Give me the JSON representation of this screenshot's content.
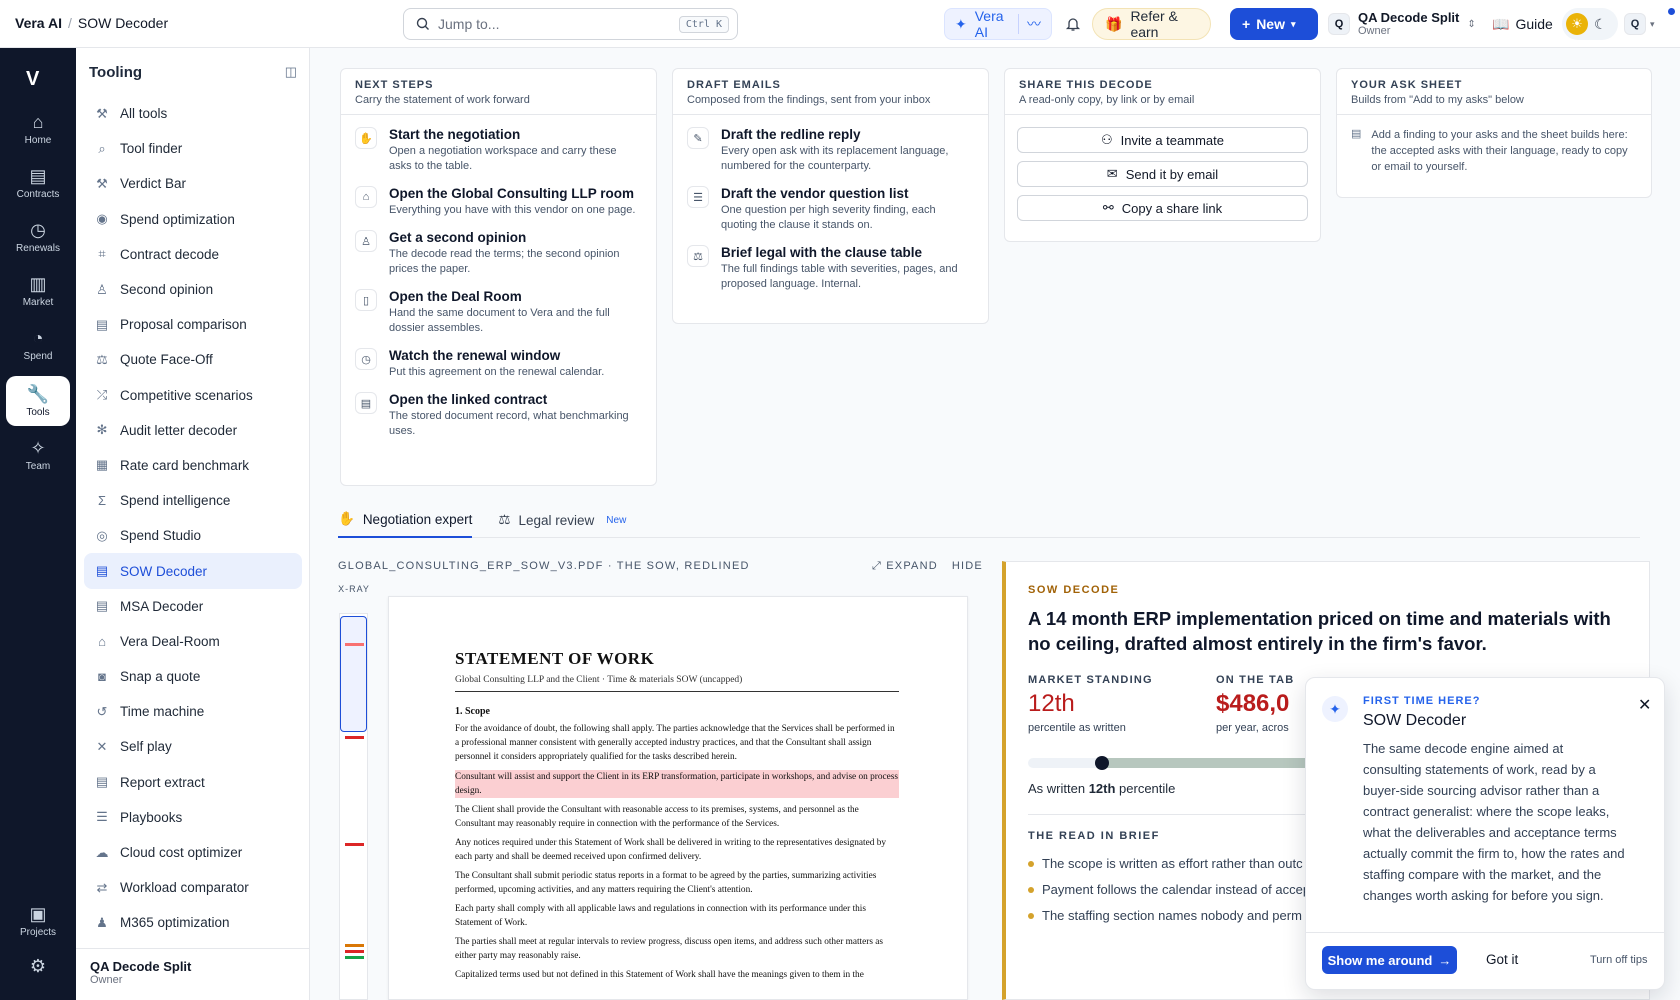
{
  "app": {
    "brand": "Vera AI",
    "page": "SOW Decoder"
  },
  "search": {
    "placeholder": "Jump to...",
    "shortcut": "Ctrl K"
  },
  "topbar": {
    "vera_label": "Vera AI",
    "refer_label": "Refer & earn",
    "new_label": "New",
    "workspace_initial": "Q",
    "workspace_name": "QA Decode Split",
    "workspace_role": "Owner",
    "guide_label": "Guide",
    "user_initial": "Q"
  },
  "rail": [
    {
      "label": "Home",
      "icon": "home-icon"
    },
    {
      "label": "Contracts",
      "icon": "contract-icon"
    },
    {
      "label": "Renewals",
      "icon": "calendar-icon"
    },
    {
      "label": "Market",
      "icon": "bar-chart-icon"
    },
    {
      "label": "Spend",
      "icon": "pie-chart-icon"
    },
    {
      "label": "Tools",
      "icon": "wrench-icon"
    },
    {
      "label": "Team",
      "icon": "sparkle-icon"
    },
    {
      "label": "Projects",
      "icon": "folder-icon"
    }
  ],
  "sidebar": {
    "title": "Tooling",
    "items": [
      "All tools",
      "Tool finder",
      "Verdict Bar",
      "Spend optimization",
      "Contract decode",
      "Second opinion",
      "Proposal comparison",
      "Quote Face-Off",
      "Competitive scenarios",
      "Audit letter decoder",
      "Rate card benchmark",
      "Spend intelligence",
      "Spend Studio",
      "SOW Decoder",
      "MSA Decoder",
      "Vera Deal-Room",
      "Snap a quote",
      "Time machine",
      "Self play",
      "Report extract",
      "Playbooks",
      "Cloud cost optimizer",
      "Workload comparator",
      "M365 optimization"
    ],
    "footer_name": "QA Decode Split",
    "footer_role": "Owner"
  },
  "next_steps": {
    "title": "NEXT STEPS",
    "subtitle": "Carry the statement of work forward",
    "items": [
      {
        "title": "Start the negotiation",
        "desc": "Open a negotiation workspace and carry these asks to the table."
      },
      {
        "title": "Open the Global Consulting LLP room",
        "desc": "Everything you have with this vendor on one page."
      },
      {
        "title": "Get a second opinion",
        "desc": "The decode read the terms; the second opinion prices the paper."
      },
      {
        "title": "Open the Deal Room",
        "desc": "Hand the same document to Vera and the full dossier assembles."
      },
      {
        "title": "Watch the renewal window",
        "desc": "Put this agreement on the renewal calendar."
      },
      {
        "title": "Open the linked contract",
        "desc": "The stored document record, what benchmarking uses."
      }
    ]
  },
  "draft_emails": {
    "title": "DRAFT EMAILS",
    "subtitle": "Composed from the findings, sent from your inbox",
    "items": [
      {
        "title": "Draft the redline reply",
        "desc": "Every open ask with its replacement language, numbered for the counterparty."
      },
      {
        "title": "Draft the vendor question list",
        "desc": "One question per high severity finding, each quoting the clause it stands on."
      },
      {
        "title": "Brief legal with the clause table",
        "desc": "The full findings table with severities, pages, and proposed language. Internal."
      }
    ]
  },
  "share": {
    "title": "SHARE THIS DECODE",
    "subtitle": "A read-only copy, by link or by email",
    "buttons": [
      "Invite a teammate",
      "Send it by email",
      "Copy a share link"
    ]
  },
  "ask_sheet": {
    "title": "YOUR ASK SHEET",
    "subtitle": "Builds from \"Add to my asks\" below",
    "body": "Add a finding to your asks and the sheet builds here: the accepted asks with their language, ready to copy or email to yourself."
  },
  "tabs": [
    {
      "label": "Negotiation expert",
      "badge": ""
    },
    {
      "label": "Legal review",
      "badge": "New"
    }
  ],
  "document": {
    "filename_label": "GLOBAL_CONSULTING_ERP_SOW_V3.PDF · THE SOW, REDLINED",
    "expand": "EXPAND",
    "hide": "HIDE",
    "xray_label": "X-RAY",
    "title": "STATEMENT OF WORK",
    "subtitle": "Global Consulting LLP and the Client · Time & materials SOW (uncapped)",
    "section": "1. Scope",
    "paragraphs": [
      "For the avoidance of doubt, the following shall apply. The parties acknowledge that the Services shall be performed in a professional manner consistent with generally accepted industry practices, and that the Consultant shall assign personnel it considers appropriately qualified for the tasks described herein.",
      "Consultant will assist and support the Client in its ERP transformation, participate in workshops, and advise on process design.",
      "The Client shall provide the Consultant with reasonable access to its premises, systems, and personnel as the Consultant may reasonably require in connection with the performance of the Services.",
      "Any notices required under this Statement of Work shall be delivered in writing to the representatives designated by each party and shall be deemed received upon confirmed delivery.",
      "The Consultant shall submit periodic status reports in a format to be agreed by the parties, summarizing activities performed, upcoming activities, and any matters requiring the Client's attention.",
      "Each party shall comply with all applicable laws and regulations in connection with its performance under this Statement of Work.",
      "The parties shall meet at regular intervals to review progress, discuss open items, and address such other matters as either party may reasonably raise.",
      "Capitalized terms used but not defined in this Statement of Work shall have the meanings given to them in the"
    ]
  },
  "decode": {
    "kicker": "SOW DECODE",
    "headline": "A 14 month ERP implementation priced on time and materials with no ceiling, drafted almost entirely in the firm's favor.",
    "market_label": "MARKET STANDING",
    "market_value": "12th",
    "market_sub": "percentile as written",
    "table_label": "ON THE TAB",
    "table_value": "$486,0",
    "table_sub": "per year, acros",
    "percentile": 12,
    "as_written_prefix": "As written ",
    "as_written_value": "12th",
    "as_written_suffix": " percentile",
    "brief_label": "THE READ IN BRIEF",
    "brief": [
      "The scope is written as effort rather than outc assist, support and advise, but never to delive",
      "Payment follows the calendar instead of accep closes after five days of silence.",
      "The staffing section names nobody and perm becomes an analyst-led delivery."
    ]
  },
  "tip": {
    "kicker": "FIRST TIME HERE?",
    "title": "SOW Decoder",
    "body": "The same decode engine aimed at consulting statements of work, read by a buyer-side sourcing advisor rather than a contract generalist: where the scope leaks, what the deliverables and acceptance terms actually commit the firm to, how the rates and staffing compare with the market, and the changes worth asking for before you sign.",
    "primary": "Show me around",
    "secondary": "Got it",
    "tertiary": "Turn off tips"
  },
  "colors": {
    "accent": "#1d4ed8",
    "gold": "#d4a22c",
    "alert": "#b91c1c",
    "rail": "#0f172a"
  }
}
